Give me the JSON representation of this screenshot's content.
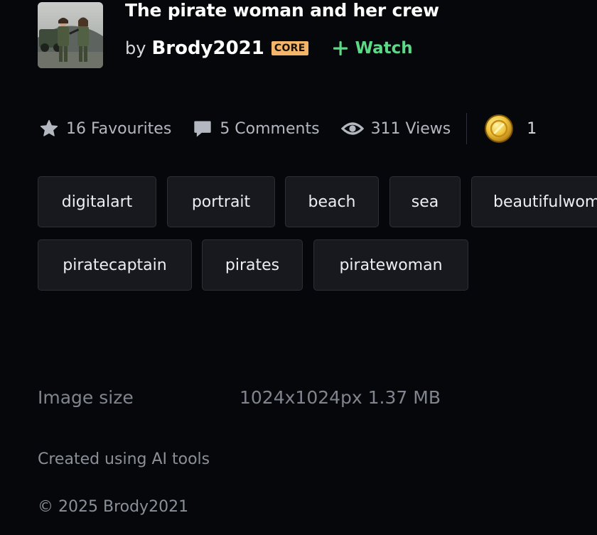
{
  "deviation": {
    "title": "The pirate woman and her crew",
    "by_word": "by",
    "author": "Brody2021",
    "badge": "CORE",
    "watch_label": "Watch"
  },
  "stats": {
    "favourites": "16 Favourites",
    "comments": "5 Comments",
    "views": "311 Views",
    "awards": "1"
  },
  "tags": [
    "digitalart",
    "portrait",
    "beach",
    "sea",
    "beautifulwomen",
    "piratecaptain",
    "pirates",
    "piratewoman"
  ],
  "details": {
    "image_size_label": "Image size",
    "image_size_value": "1024x1024px 1.37 MB",
    "created_note": "Created using AI tools",
    "copyright": "© 2025 Brody2021"
  },
  "colors": {
    "background": "#06070b",
    "watch_green": "#5cd987",
    "core_badge": "#f2b56a",
    "tag_bg": "#17191e"
  }
}
